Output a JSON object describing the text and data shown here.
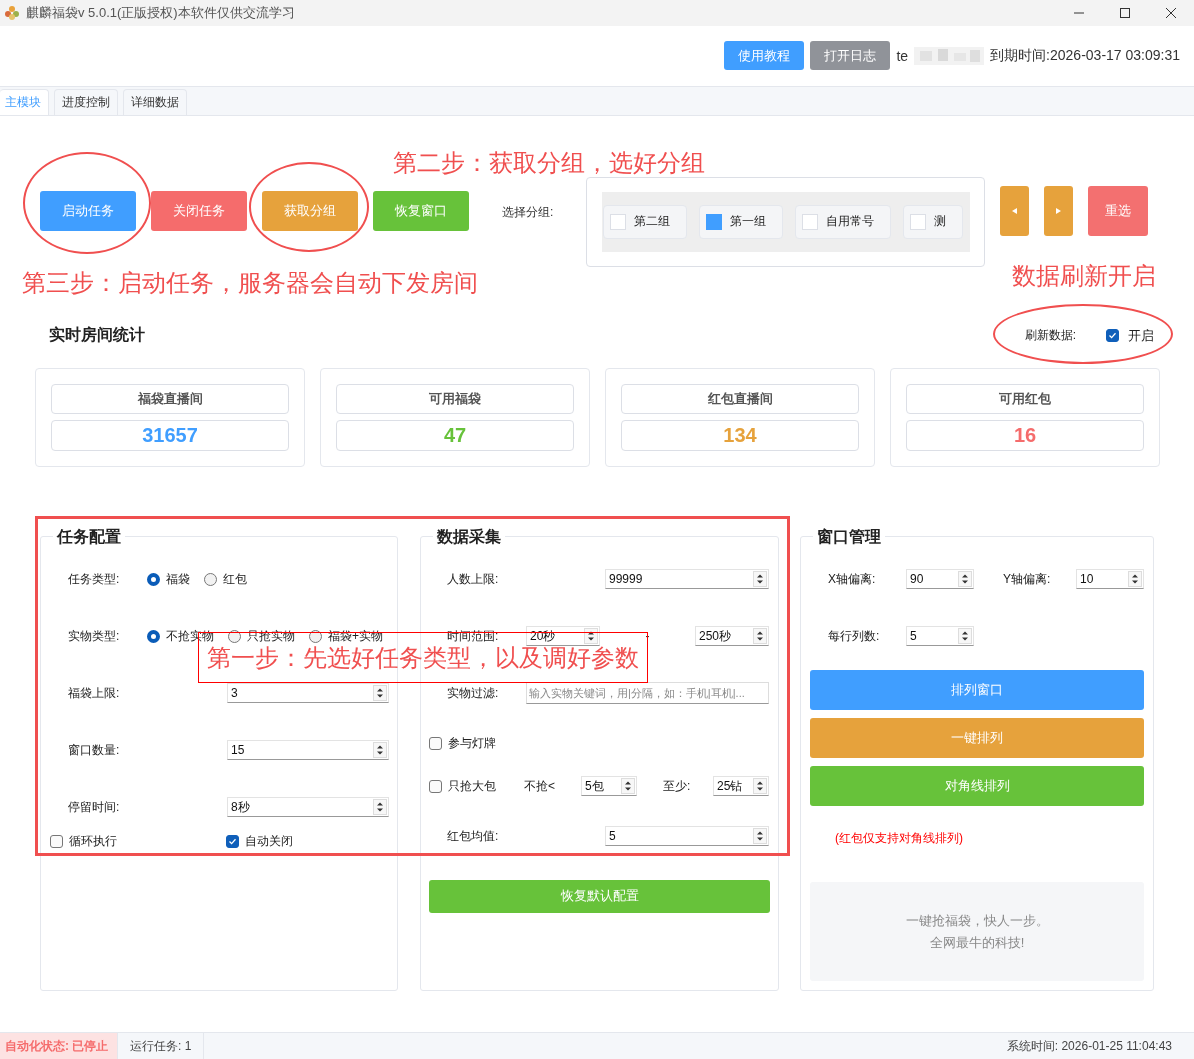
{
  "window": {
    "title": "麒麟福袋v 5.0.1(正版授权)本软件仅供交流学习"
  },
  "header": {
    "buttons": [
      {
        "label": "使用教程",
        "kind": "primary"
      },
      {
        "label": "打开日志",
        "kind": "info"
      }
    ],
    "user": "te",
    "expiry": "到期时间:2026-03-17 03:09:31"
  },
  "tabs": [
    {
      "label": "主模块",
      "selected": true
    },
    {
      "label": "进度控制",
      "selected": false
    },
    {
      "label": "详细数据",
      "selected": false
    }
  ],
  "actions": [
    {
      "label": "启动任务",
      "kind": "primary"
    },
    {
      "label": "关闭任务",
      "kind": "danger"
    },
    {
      "label": "获取分组",
      "kind": "warning"
    },
    {
      "label": "恢复窗口",
      "kind": "success"
    }
  ],
  "group_picker": {
    "label": "选择分组:",
    "groups": [
      {
        "label": "第二组",
        "checked": false
      },
      {
        "label": "第一组",
        "checked": true
      },
      {
        "label": "自用常号",
        "checked": false
      },
      {
        "label": "测",
        "checked": false
      }
    ],
    "reset": "重选"
  },
  "stats": {
    "title": "实时房间统计",
    "refresh": {
      "label": "刷新数据:",
      "option": "开启",
      "checked": true
    },
    "cards": [
      {
        "label": "福袋直播间",
        "value": "31657",
        "kind": "primary"
      },
      {
        "label": "可用福袋",
        "value": "47",
        "kind": "success"
      },
      {
        "label": "红包直播间",
        "value": "134",
        "kind": "warning"
      },
      {
        "label": "可用红包",
        "value": "16",
        "kind": "danger"
      }
    ]
  },
  "task_config": {
    "title": "任务配置",
    "rows": [
      {
        "kind": "radio",
        "label": "任务类型:",
        "options": [
          {
            "label": "福袋",
            "selected": true
          },
          {
            "label": "红包",
            "selected": false
          }
        ]
      },
      {
        "kind": "radio",
        "label": "实物类型:",
        "options": [
          {
            "label": "不抢实物",
            "selected": true
          },
          {
            "label": "只抢实物",
            "selected": false
          },
          {
            "label": "福袋+实物",
            "selected": false
          }
        ]
      },
      {
        "kind": "spin",
        "label": "福袋上限:",
        "value": "3"
      },
      {
        "kind": "spin",
        "label": "窗口数量:",
        "value": "15"
      },
      {
        "kind": "spin",
        "label": "停留时间:",
        "value": "8秒"
      }
    ],
    "checks": [
      {
        "label": "循环执行",
        "checked": false
      },
      {
        "label": "自动关闭",
        "checked": true
      }
    ]
  },
  "data_collection": {
    "title": "数据采集",
    "rows": [
      {
        "kind": "spin",
        "label": "人数上限:",
        "value": "99999"
      },
      {
        "kind": "range",
        "label": "时间范围:",
        "from": "20秒",
        "separator": "-",
        "to": "250秒"
      },
      {
        "kind": "filter",
        "label": "实物过滤:",
        "placeholder": "输入实物关键词，用|分隔，如：手机|耳机|..."
      },
      {
        "kind": "check",
        "label": "参与灯牌",
        "checked": false
      },
      {
        "kind": "bigpack",
        "label": "只抢大包",
        "checked": false,
        "skip_label": "不抢<",
        "skip_value": "5包",
        "min_label": "至少:",
        "min_value": "25钻"
      },
      {
        "kind": "spin",
        "label": "红包均值:",
        "value": "5"
      }
    ],
    "button": "恢复默认配置"
  },
  "window_manager": {
    "title": "窗口管理",
    "offsets": [
      {
        "label": "X轴偏离:",
        "value": "90"
      },
      {
        "label": "Y轴偏离:",
        "value": "10"
      }
    ],
    "columns": {
      "label": "每行列数:",
      "value": "5"
    },
    "buttons": [
      {
        "label": "排列窗口",
        "kind": "primary"
      },
      {
        "label": "一键排列",
        "kind": "warning"
      },
      {
        "label": "对角线排列",
        "kind": "success"
      }
    ],
    "note": "(红包仅支持对角线排列)",
    "slogan": [
      "一键抢福袋，快人一步。",
      "全网最牛的科技!"
    ]
  },
  "status_bar": {
    "state": "自动化状态: 已停止",
    "tasks": "运行任务: 1",
    "time": "系统时间: 2026-01-25 11:04:43"
  },
  "annotations": [
    {
      "kind": "text",
      "text": "第二步：获取分组，选好分组"
    },
    {
      "kind": "text",
      "text": "第三步：启动任务，服务器会自动下发房间"
    },
    {
      "kind": "text",
      "text": "数据刷新开启"
    },
    {
      "kind": "callout",
      "text": "第一步：先选好任务类型，以及调好参数"
    },
    {
      "kind": "ellipse"
    },
    {
      "kind": "ellipse"
    },
    {
      "kind": "ellipse"
    },
    {
      "kind": "frame"
    }
  ]
}
